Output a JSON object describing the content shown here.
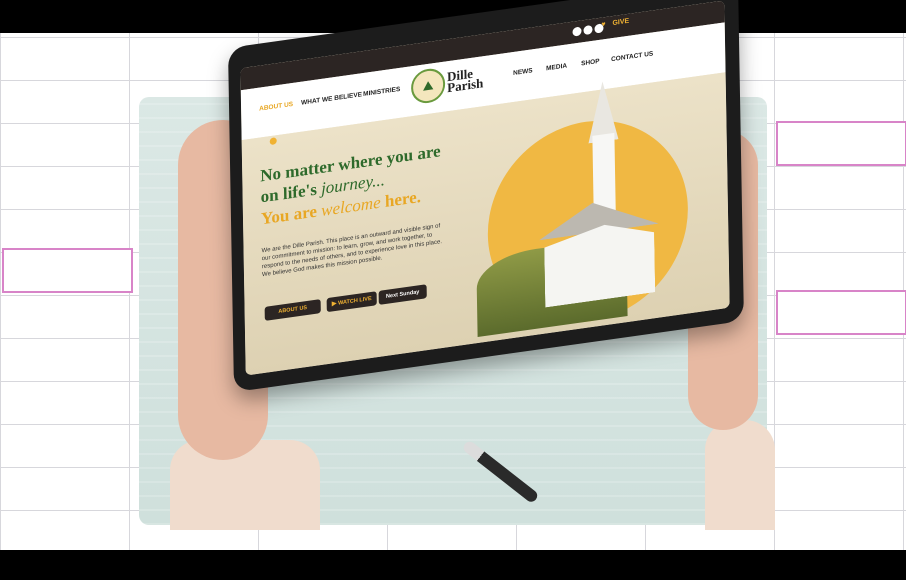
{
  "social_icons": [
    "facebook-icon",
    "instagram-icon",
    "youtube-icon"
  ],
  "topbar": {
    "give_label": "GIVE"
  },
  "nav": {
    "left": [
      "ABOUT US",
      "WHAT WE BELIEVE",
      "MINISTRIES"
    ],
    "right": [
      "NEWS",
      "MEDIA",
      "SHOP",
      "CONTACT US"
    ],
    "brand_line1": "Dille",
    "brand_line2": "Parish"
  },
  "hero": {
    "line1": "No matter where you are",
    "line2a": "on life's ",
    "line2b": "journey...",
    "line3a": "You are ",
    "line3b": "welcome",
    "line3c": " here.",
    "body": "We are the Dille Parish. This place is an outward and visible sign of our commitment to mission: to learn, grow, and work together, to respond to the needs of others, and to experience love in this place. We believe God makes this mission possible.",
    "buttons": {
      "about": "ABOUT US",
      "watch": "WATCH LIVE",
      "next": "Next Sunday"
    }
  },
  "colors": {
    "green": "#2e6a2b",
    "gold": "#e8a724",
    "dark": "#2c2523"
  }
}
